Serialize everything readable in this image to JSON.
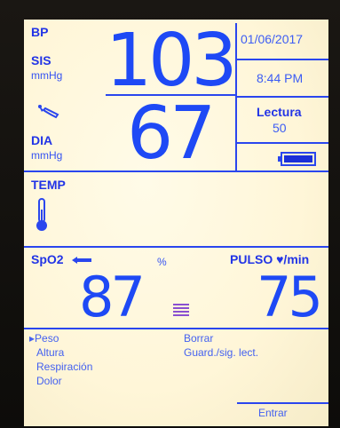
{
  "bp": {
    "label": "BP",
    "sys_label": "SIS",
    "sys_unit": "mmHg",
    "sys_value": "103",
    "dia_label": "DIA",
    "dia_unit": "mmHg",
    "dia_value": "67",
    "cuff_icon": "cuff-icon"
  },
  "status": {
    "date": "01/06/2017",
    "time": "8:44 PM",
    "reading_label": "Lectura",
    "reading_value": "50",
    "battery_icon": "battery-icon",
    "battery_level": 1.0
  },
  "temp": {
    "label": "TEMP",
    "thermometer_icon": "thermometer-icon"
  },
  "spo2": {
    "label": "SpO2",
    "unit": "%",
    "value": "87",
    "signal_icon": "signal-icon",
    "bar_icon": "signal-strength-bars-icon"
  },
  "pulse": {
    "label": "PULSO ♥/min",
    "value": "75"
  },
  "menu": {
    "items_left": [
      "▸Peso",
      "Altura",
      "Respiración",
      "Dolor"
    ],
    "items_right": [
      "Borrar",
      "Guard./sig. lect."
    ],
    "enter_label": "Entrar"
  },
  "colors": {
    "screen_bg": "#fff8dc",
    "accent_blue": "#1e49f5",
    "bars_purple": "#8a4fd0"
  }
}
